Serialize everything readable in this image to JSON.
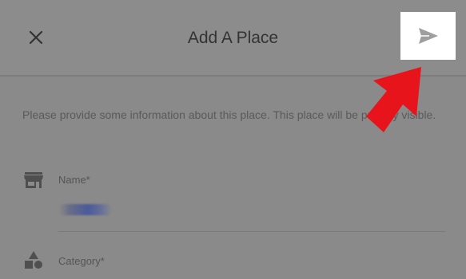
{
  "header": {
    "title": "Add A Place",
    "close_icon": "close-icon",
    "send_icon": "send-icon"
  },
  "form": {
    "intro": "Please provide some information about this place. This place will be publicly visible.",
    "name": {
      "label": "Name*",
      "icon": "store-icon",
      "value_redacted": true
    },
    "category": {
      "label": "Category*",
      "icon": "category-shapes-icon"
    }
  },
  "annotation": {
    "icon": "red-arrow-icon",
    "color": "#e8141c"
  },
  "colors": {
    "overlay": "#8a8a8a",
    "highlight": "#ffffff",
    "arrow": "#e8141c"
  }
}
